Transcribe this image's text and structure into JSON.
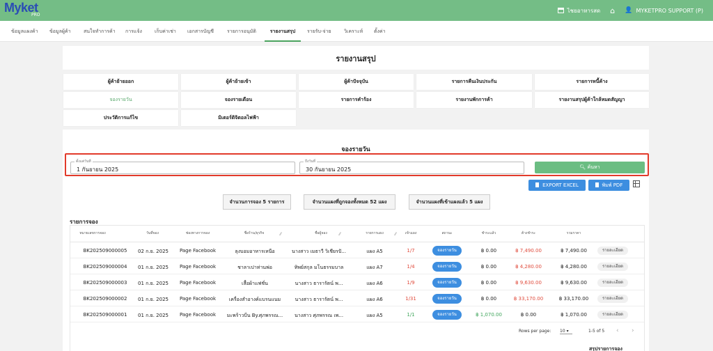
{
  "app": {
    "logo": "Myket",
    "logo_sub": "PRO"
  },
  "topbar": {
    "store": "ไชยอาหารสด",
    "user": "MYKETPRO SUPPORT (P)"
  },
  "nav": [
    {
      "label": "ข้อมูลแผงค้า"
    },
    {
      "label": "ข้อมูลผู้ค้า"
    },
    {
      "label": "สนใจทำการค้า"
    },
    {
      "label": "การแจ้ง"
    },
    {
      "label": "เก็บค่าเช่า"
    },
    {
      "label": "เอกสารบัญชี"
    },
    {
      "label": "รายการอนุมัติ"
    },
    {
      "label": "รายงานสรุป"
    },
    {
      "label": "รายรับ-จ่าย"
    },
    {
      "label": "วิเคราะห์"
    },
    {
      "label": "ตั้งค่า"
    }
  ],
  "page_title": "รายงานสรุป",
  "tiles": [
    {
      "label": "ผู้ค้าย้ายออก"
    },
    {
      "label": "ผู้ค้าย้ายเข้า"
    },
    {
      "label": "ผู้ค้าปัจจุบัน"
    },
    {
      "label": "รายการคืนเงินประกัน"
    },
    {
      "label": "รายการหนี้ค้าง"
    },
    {
      "label": "จองรายวัน"
    },
    {
      "label": "จองรายเดือน"
    },
    {
      "label": "รายการคำร้อง"
    },
    {
      "label": "รายงานพักการค้า"
    },
    {
      "label": "รายงานสรุปผู้ค้าใกล้หมดสัญญา"
    },
    {
      "label": "ประวัติการแก้ไข"
    },
    {
      "label": "มิเตอร์ดิจิตอลไฟฟ้า"
    }
  ],
  "section_title": "จองรายวัน",
  "search": {
    "from_label": "ตั้งแต่วันที่",
    "from_value": "1 กันยายน 2025",
    "to_label": "ถึงวันที่",
    "to_value": "30 กันยายน 2025",
    "button": "ค้นหา"
  },
  "export": {
    "excel": "EXPORT EXCEL",
    "pdf": "พิมพ์ PDF"
  },
  "summary": [
    {
      "label": "จำนวนการจอง 5 รายการ"
    },
    {
      "label": "จำนวนแผงที่ถูกจองทั้งหมด 52 แผง"
    },
    {
      "label": "จำนวนแผงที่เข้าแผงแล้ว 5 แผง"
    }
  ],
  "list_title": "รายการจอง",
  "table": {
    "headers": [
      "หมายเลขการจอง",
      "วันที่จอง",
      "ช่องทางการจอง",
      "ชื่อร้าน/ธุรกิจ",
      "ชื่อผู้จอง",
      "รายการแผง",
      "เข้าแผง",
      "สถานะ",
      "ชำระแล้ว",
      "ค้างชำระ",
      "รวมราคา"
    ],
    "rows": [
      {
        "id": "BK202509000005",
        "date": "02 ก.ย. 2025",
        "channel": "Page Facebook",
        "shop": "ลุงบอมอาหารเหนือ",
        "booker": "นางสาว เมธาวี วิเชียรปั...",
        "stall": "แผง A5",
        "checkin": "1/7",
        "status": "จองรายวัน",
        "paid": "฿ 0.00",
        "due": "฿ 7,490.00",
        "total": "฿ 7,490.00",
        "detail": "รายละเอียด"
      },
      {
        "id": "BK202509000004",
        "date": "01 ก.ย. 2025",
        "channel": "Page Facebook",
        "shop": "ชาลาเปาท่านพ่อ",
        "booker": "ทิพย์สกุล มโนธรรมบาล",
        "stall": "แผง A7",
        "checkin": "1/4",
        "status": "จองรายวัน",
        "paid": "฿ 0.00",
        "due": "฿ 4,280.00",
        "total": "฿ 4,280.00",
        "detail": "รายละเอียด"
      },
      {
        "id": "BK202509000003",
        "date": "01 ก.ย. 2025",
        "channel": "Page Facebook",
        "shop": "เสื้อผ้าแฟชั่น",
        "booker": "นางสาว ธารารัตน์ พ...",
        "stall": "แผง A6",
        "checkin": "1/9",
        "status": "จองรายวัน",
        "paid": "฿ 0.00",
        "due": "฿ 9,630.00",
        "total": "฿ 9,630.00",
        "detail": "รายละเอียด"
      },
      {
        "id": "BK202509000002",
        "date": "01 ก.ย. 2025",
        "channel": "Page Facebook",
        "shop": "เครื่องสำอางค์แบรนแนม",
        "booker": "นางสาว ธารารัตน์ พ...",
        "stall": "แผง A6",
        "checkin": "1/31",
        "status": "จองรายวัน",
        "paid": "฿ 0.00",
        "due": "฿ 33,170.00",
        "total": "฿ 33,170.00",
        "detail": "รายละเอียด"
      },
      {
        "id": "BK202509000001",
        "date": "01 ก.ย. 2025",
        "channel": "Page Facebook",
        "shop": "มะพร้าวปั่น By.ศุภพรรณ...",
        "booker": "นางสาว ศุภพรรณ เพ...",
        "stall": "แผง A5",
        "checkin": "1/1",
        "status": "จองรายวัน",
        "paid": "฿ 1,070.00",
        "due": "฿ 0.00",
        "total": "฿ 1,070.00",
        "detail": "รายละเอียด"
      }
    ]
  },
  "pagination": {
    "rows_label": "Rows per page:",
    "rows_value": "10",
    "range": "1-5 of 5"
  },
  "bottom_peek": "สรุปรายการจอง",
  "colors": {
    "brand_green": "#74bd86",
    "accent_blue": "#3d8ee0",
    "highlight_red": "#e23a2a"
  }
}
